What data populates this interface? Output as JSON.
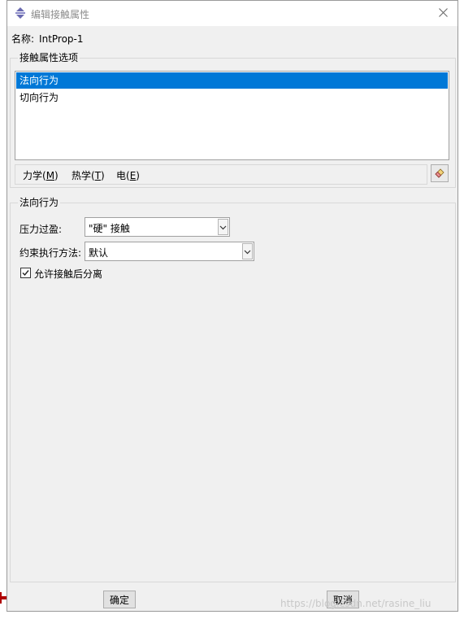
{
  "window": {
    "title": "编辑接触属性",
    "title_icon": "abaqus-interaction-icon",
    "close_icon": "close-icon"
  },
  "name_field": {
    "label": "名称:",
    "value": "IntProp-1"
  },
  "options_group": {
    "caption": "接触属性选项",
    "items": [
      {
        "label": "法向行为",
        "selected": true
      },
      {
        "label": "切向行为",
        "selected": false
      }
    ]
  },
  "menu": {
    "mechanical": {
      "text": "力学(",
      "key": "M",
      "end": ")"
    },
    "thermal": {
      "text": "热学(",
      "key": "T",
      "end": ")"
    },
    "electrical": {
      "text": "电(",
      "key": "E",
      "end": ")"
    },
    "delete_icon": "eraser-icon"
  },
  "behavior_group": {
    "caption": "法向行为",
    "pressure_overclosure": {
      "label": "压力过盈:",
      "value": "\"硬\" 接触"
    },
    "constraint_method": {
      "label": "约束执行方法:",
      "value": "默认"
    },
    "allow_separation": {
      "label": "允许接触后分离",
      "checked": true
    }
  },
  "buttons": {
    "ok": "确定",
    "cancel": "取消"
  },
  "watermark": "https://blog.csdn.net/rasine_liu",
  "colors": {
    "selection": "#0078d7",
    "dialog_bg": "#f0f0f0"
  }
}
